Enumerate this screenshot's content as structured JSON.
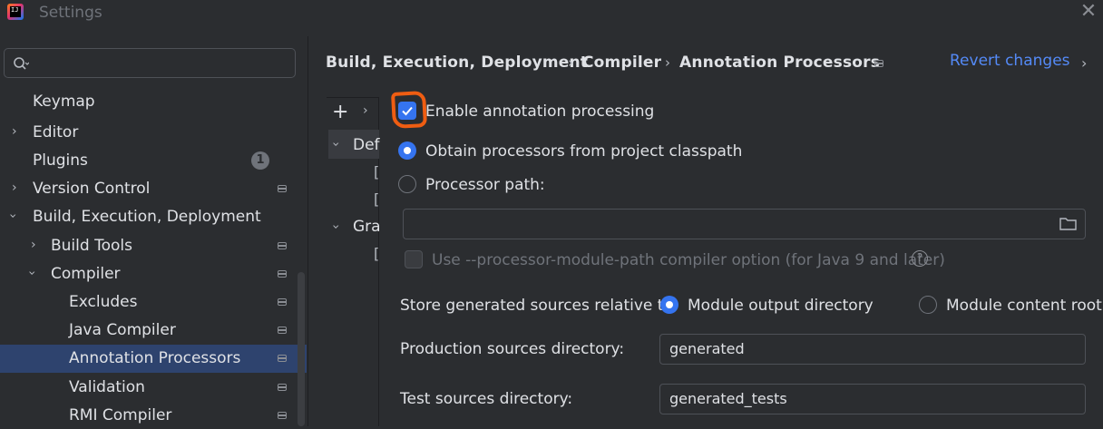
{
  "window": {
    "title": "Settings",
    "app_logo_text": "IJ"
  },
  "search": {
    "placeholder": ""
  },
  "sidebar": {
    "items": [
      {
        "label": "Keymap"
      },
      {
        "label": "Editor"
      },
      {
        "label": "Plugins",
        "badge": "1"
      },
      {
        "label": "Version Control"
      },
      {
        "label": "Build, Execution, Deployment"
      },
      {
        "label": "Build Tools"
      },
      {
        "label": "Compiler"
      },
      {
        "label": "Excludes"
      },
      {
        "label": "Java Compiler"
      },
      {
        "label": "Annotation Processors",
        "selected": true
      },
      {
        "label": "Validation"
      },
      {
        "label": "RMI Compiler"
      }
    ]
  },
  "breadcrumb": {
    "items": [
      "Build, Execution, Deployment",
      "Compiler",
      "Annotation Processors"
    ],
    "separator": "›"
  },
  "header": {
    "revert_label": "Revert changes",
    "more": "›"
  },
  "profiles": {
    "add": "+",
    "expand": "›",
    "items": [
      "Def",
      "Gra"
    ],
    "sub_brackets": [
      "[",
      "[",
      "["
    ]
  },
  "form": {
    "enable_label": "Enable annotation processing",
    "enable_checked": true,
    "obtain_label": "Obtain processors from project classpath",
    "processor_path_label": "Processor path:",
    "processor_path_value": "",
    "module_path_label": "Use --processor-module-path compiler option (for Java 9 and later)",
    "help": "?",
    "store_label": "Store generated sources relative to:",
    "store_options": [
      "Module output directory",
      "Module content root"
    ],
    "production_label": "Production sources directory:",
    "production_value": "generated",
    "test_label": "Test sources directory:",
    "test_value": "generated_tests"
  },
  "colors": {
    "accent": "#3574f0",
    "selection": "#2e436e",
    "link": "#548af7",
    "highlight": "#ef5d12"
  }
}
